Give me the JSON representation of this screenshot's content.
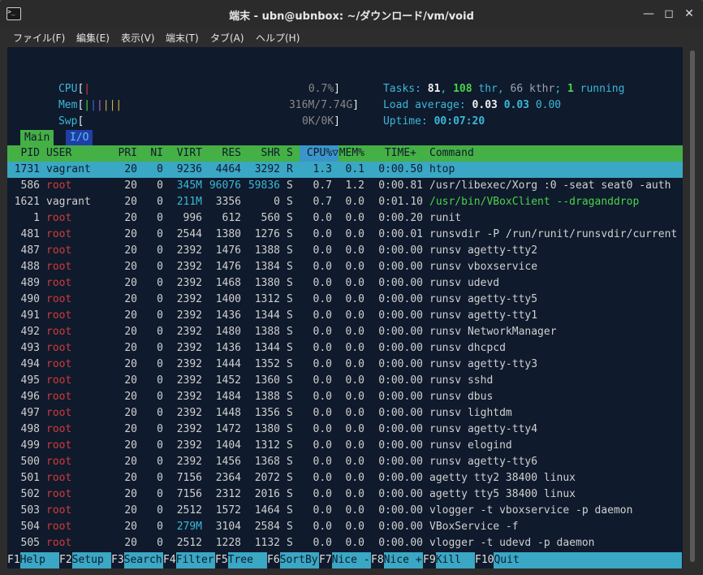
{
  "window": {
    "title": "端末 - ubn@ubnbox: ~/ダウンロード/vm/void",
    "app_icon": "terminal-icon"
  },
  "menubar": {
    "items": [
      {
        "label": "ファイル(F)"
      },
      {
        "label": "編集(E)"
      },
      {
        "label": "表示(V)"
      },
      {
        "label": "端末(T)"
      },
      {
        "label": "タブ(A)"
      },
      {
        "label": "ヘルプ(H)"
      }
    ]
  },
  "htop": {
    "cpu": {
      "label": "CPU",
      "value": "0.7%",
      "usage_percent": 0.7
    },
    "mem": {
      "label": "Mem",
      "value": "316M/7.74G"
    },
    "swp": {
      "label": "Swp",
      "value": "0K/0K"
    },
    "tasks": {
      "label": "Tasks:",
      "count": "81",
      "thr": "108",
      "thr_label": "thr",
      "kthr": "66 kthr",
      "running": "1",
      "running_label": "running"
    },
    "load": {
      "label": "Load average:",
      "v1": "0.03",
      "v5": "0.03",
      "v15": "0.00"
    },
    "uptime": {
      "label": "Uptime:",
      "value": "00:07:20"
    },
    "tabs": [
      {
        "label": "Main"
      },
      {
        "label": "I/O"
      }
    ],
    "columns": [
      "PID",
      "USER",
      "PRI",
      "NI",
      "VIRT",
      "RES",
      "SHR",
      "S",
      "CPU%▽",
      "MEM%",
      "TIME+",
      "Command"
    ],
    "processes": [
      {
        "pid": "1731",
        "user": "vagrant",
        "pri": "20",
        "ni": "0",
        "virt": "9236",
        "res": "4464",
        "shr": "3292",
        "s": "R",
        "cpu": "1.3",
        "mem": "0.1",
        "time": "0:00.50",
        "cmd": "htop"
      },
      {
        "pid": "586",
        "user": "root",
        "pri": "20",
        "ni": "0",
        "virt": "345M",
        "res": "96076",
        "shr": "59836",
        "s": "S",
        "cpu": "0.7",
        "mem": "1.2",
        "time": "0:00.81",
        "cmd": "/usr/libexec/Xorg :0 -seat seat0 -auth"
      },
      {
        "pid": "1621",
        "user": "vagrant",
        "pri": "20",
        "ni": "0",
        "virt": "211M",
        "res": "3356",
        "shr": "0",
        "s": "S",
        "cpu": "0.7",
        "mem": "0.0",
        "time": "0:01.10",
        "cmd": "/usr/bin/VBoxClient --draganddrop"
      },
      {
        "pid": "1",
        "user": "root",
        "pri": "20",
        "ni": "0",
        "virt": "996",
        "res": "612",
        "shr": "560",
        "s": "S",
        "cpu": "0.0",
        "mem": "0.0",
        "time": "0:00.20",
        "cmd": "runit"
      },
      {
        "pid": "481",
        "user": "root",
        "pri": "20",
        "ni": "0",
        "virt": "2544",
        "res": "1380",
        "shr": "1276",
        "s": "S",
        "cpu": "0.0",
        "mem": "0.0",
        "time": "0:00.01",
        "cmd": "runsvdir -P /run/runit/runsvdir/current"
      },
      {
        "pid": "487",
        "user": "root",
        "pri": "20",
        "ni": "0",
        "virt": "2392",
        "res": "1476",
        "shr": "1388",
        "s": "S",
        "cpu": "0.0",
        "mem": "0.0",
        "time": "0:00.00",
        "cmd": "runsv agetty-tty2"
      },
      {
        "pid": "488",
        "user": "root",
        "pri": "20",
        "ni": "0",
        "virt": "2392",
        "res": "1476",
        "shr": "1384",
        "s": "S",
        "cpu": "0.0",
        "mem": "0.0",
        "time": "0:00.00",
        "cmd": "runsv vboxservice"
      },
      {
        "pid": "489",
        "user": "root",
        "pri": "20",
        "ni": "0",
        "virt": "2392",
        "res": "1468",
        "shr": "1380",
        "s": "S",
        "cpu": "0.0",
        "mem": "0.0",
        "time": "0:00.00",
        "cmd": "runsv udevd"
      },
      {
        "pid": "490",
        "user": "root",
        "pri": "20",
        "ni": "0",
        "virt": "2392",
        "res": "1400",
        "shr": "1312",
        "s": "S",
        "cpu": "0.0",
        "mem": "0.0",
        "time": "0:00.00",
        "cmd": "runsv agetty-tty5"
      },
      {
        "pid": "491",
        "user": "root",
        "pri": "20",
        "ni": "0",
        "virt": "2392",
        "res": "1436",
        "shr": "1344",
        "s": "S",
        "cpu": "0.0",
        "mem": "0.0",
        "time": "0:00.00",
        "cmd": "runsv agetty-tty1"
      },
      {
        "pid": "492",
        "user": "root",
        "pri": "20",
        "ni": "0",
        "virt": "2392",
        "res": "1480",
        "shr": "1388",
        "s": "S",
        "cpu": "0.0",
        "mem": "0.0",
        "time": "0:00.00",
        "cmd": "runsv NetworkManager"
      },
      {
        "pid": "493",
        "user": "root",
        "pri": "20",
        "ni": "0",
        "virt": "2392",
        "res": "1436",
        "shr": "1344",
        "s": "S",
        "cpu": "0.0",
        "mem": "0.0",
        "time": "0:00.00",
        "cmd": "runsv dhcpcd"
      },
      {
        "pid": "494",
        "user": "root",
        "pri": "20",
        "ni": "0",
        "virt": "2392",
        "res": "1444",
        "shr": "1352",
        "s": "S",
        "cpu": "0.0",
        "mem": "0.0",
        "time": "0:00.00",
        "cmd": "runsv agetty-tty3"
      },
      {
        "pid": "495",
        "user": "root",
        "pri": "20",
        "ni": "0",
        "virt": "2392",
        "res": "1452",
        "shr": "1360",
        "s": "S",
        "cpu": "0.0",
        "mem": "0.0",
        "time": "0:00.00",
        "cmd": "runsv sshd"
      },
      {
        "pid": "496",
        "user": "root",
        "pri": "20",
        "ni": "0",
        "virt": "2392",
        "res": "1484",
        "shr": "1388",
        "s": "S",
        "cpu": "0.0",
        "mem": "0.0",
        "time": "0:00.00",
        "cmd": "runsv dbus"
      },
      {
        "pid": "497",
        "user": "root",
        "pri": "20",
        "ni": "0",
        "virt": "2392",
        "res": "1448",
        "shr": "1356",
        "s": "S",
        "cpu": "0.0",
        "mem": "0.0",
        "time": "0:00.00",
        "cmd": "runsv lightdm"
      },
      {
        "pid": "498",
        "user": "root",
        "pri": "20",
        "ni": "0",
        "virt": "2392",
        "res": "1472",
        "shr": "1380",
        "s": "S",
        "cpu": "0.0",
        "mem": "0.0",
        "time": "0:00.00",
        "cmd": "runsv agetty-tty4"
      },
      {
        "pid": "499",
        "user": "root",
        "pri": "20",
        "ni": "0",
        "virt": "2392",
        "res": "1404",
        "shr": "1312",
        "s": "S",
        "cpu": "0.0",
        "mem": "0.0",
        "time": "0:00.00",
        "cmd": "runsv elogind"
      },
      {
        "pid": "500",
        "user": "root",
        "pri": "20",
        "ni": "0",
        "virt": "2392",
        "res": "1456",
        "shr": "1368",
        "s": "S",
        "cpu": "0.0",
        "mem": "0.0",
        "time": "0:00.00",
        "cmd": "runsv agetty-tty6"
      },
      {
        "pid": "501",
        "user": "root",
        "pri": "20",
        "ni": "0",
        "virt": "7156",
        "res": "2364",
        "shr": "2072",
        "s": "S",
        "cpu": "0.0",
        "mem": "0.0",
        "time": "0:00.00",
        "cmd": "agetty tty2 38400 linux"
      },
      {
        "pid": "502",
        "user": "root",
        "pri": "20",
        "ni": "0",
        "virt": "7156",
        "res": "2312",
        "shr": "2016",
        "s": "S",
        "cpu": "0.0",
        "mem": "0.0",
        "time": "0:00.00",
        "cmd": "agetty tty5 38400 linux"
      },
      {
        "pid": "503",
        "user": "root",
        "pri": "20",
        "ni": "0",
        "virt": "2512",
        "res": "1572",
        "shr": "1464",
        "s": "S",
        "cpu": "0.0",
        "mem": "0.0",
        "time": "0:00.00",
        "cmd": "vlogger -t vboxservice -p daemon"
      },
      {
        "pid": "504",
        "user": "root",
        "pri": "20",
        "ni": "0",
        "virt": "279M",
        "res": "3104",
        "shr": "2584",
        "s": "S",
        "cpu": "0.0",
        "mem": "0.0",
        "time": "0:00.00",
        "cmd": "VBoxService -f"
      },
      {
        "pid": "505",
        "user": "root",
        "pri": "20",
        "ni": "0",
        "virt": "2512",
        "res": "1228",
        "shr": "1132",
        "s": "S",
        "cpu": "0.0",
        "mem": "0.0",
        "time": "0:00.00",
        "cmd": "vlogger -t udevd -p daemon"
      }
    ],
    "fkeys": [
      {
        "key": "F1",
        "label": "Help"
      },
      {
        "key": "F2",
        "label": "Setup"
      },
      {
        "key": "F3",
        "label": "Search"
      },
      {
        "key": "F4",
        "label": "Filter"
      },
      {
        "key": "F5",
        "label": "Tree"
      },
      {
        "key": "F6",
        "label": "SortBy"
      },
      {
        "key": "F7",
        "label": "Nice -"
      },
      {
        "key": "F8",
        "label": "Nice +"
      },
      {
        "key": "F9",
        "label": "Kill"
      },
      {
        "key": "F10",
        "label": "Quit"
      }
    ]
  },
  "colors": {
    "terminal_bg": "#0f1a2c",
    "header_green": "#45b045",
    "selection_cyan": "#3aa7c4",
    "text_cyan": "#3bb8d8"
  }
}
